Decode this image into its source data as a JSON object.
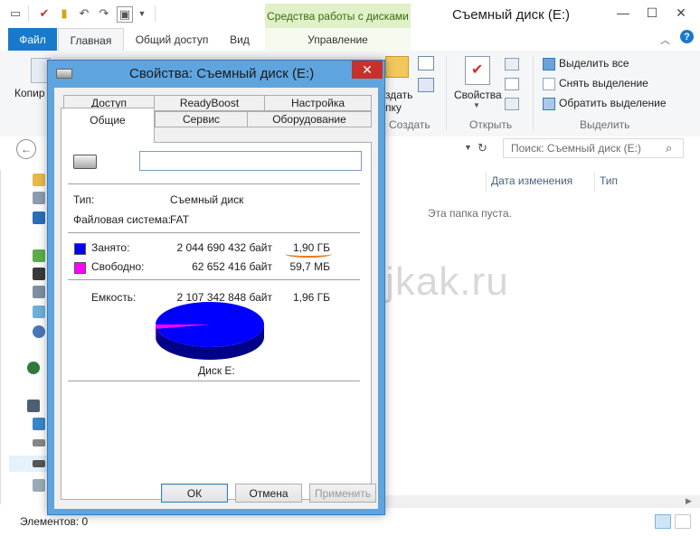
{
  "explorer": {
    "title": "Съемный диск (E:)",
    "context_header": "Средства работы с дисками",
    "tabs": {
      "file": "Файл",
      "home": "Главная",
      "share": "Общий доступ",
      "view": "Вид",
      "manage": "Управление"
    },
    "ribbon": {
      "copy_partial": "Копир",
      "new_folder_line1": "здать",
      "new_folder_line2": "пку",
      "group_create": "Создать",
      "properties": "Свойства",
      "group_open": "Открыть",
      "select_all": "Выделить все",
      "select_none": "Снять выделение",
      "invert_selection": "Обратить выделение",
      "group_select": "Выделить"
    },
    "search_placeholder": "Поиск: Съемный диск (E:)",
    "columns": {
      "date_modified": "Дата изменения",
      "type": "Тип"
    },
    "empty_message": "Эта папка пуста.",
    "status": "Элементов: 0",
    "watermark": "dumajkak.ru"
  },
  "dialog": {
    "title": "Свойства: Съемный диск (E:)",
    "tabs": {
      "access": "Доступ",
      "readyboost": "ReadyBoost",
      "customize": "Настройка",
      "general": "Общие",
      "tools": "Сервис",
      "hardware": "Оборудование"
    },
    "name_value": "",
    "type_label": "Тип:",
    "type_value": "Съемный диск",
    "fs_label": "Файловая система:",
    "fs_value": "FAT",
    "used_label": "Занято:",
    "used_bytes": "2 044 690 432 байт",
    "used_short": "1,90 ГБ",
    "free_label": "Свободно:",
    "free_bytes": "62 652 416 байт",
    "free_short": "59,7 МБ",
    "capacity_label": "Емкость:",
    "capacity_bytes": "2 107 342 848 байт",
    "capacity_short": "1,96 ГБ",
    "disk_label": "Диск E:",
    "buttons": {
      "ok": "ОК",
      "cancel": "Отмена",
      "apply": "Применить"
    },
    "usage": {
      "used_bytes": 2044690432,
      "free_bytes": 62652416,
      "used_color": "#0000ff",
      "free_color": "#ff00ff"
    }
  }
}
